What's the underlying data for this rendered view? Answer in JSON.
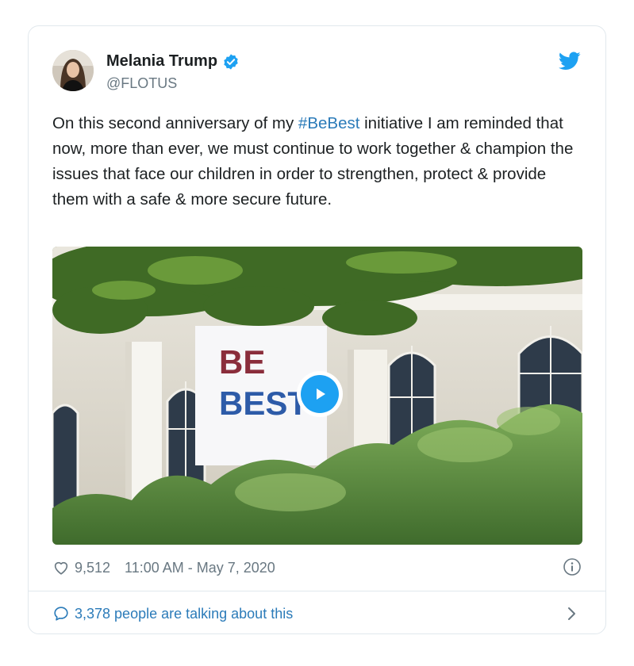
{
  "author": {
    "name": "Melania Trump",
    "handle": "@FLOTUS",
    "verified": true
  },
  "tweet": {
    "text_before": "On this second anniversary of my ",
    "hashtag": "#BeBest",
    "text_after": " initiative I am reminded that now, more than ever, we must continue to work together & champion the issues that face our children in order to strengthen, protect & provide them with a safe & more secure future."
  },
  "media": {
    "type": "video",
    "sign_line1": "BE",
    "sign_line2": "BEST",
    "icon": "play-icon"
  },
  "meta": {
    "likes": "9,512",
    "timestamp": "11:00 AM - May 7, 2020"
  },
  "footer": {
    "talking": "3,378 people are talking about this"
  },
  "colors": {
    "link": "#2b7bb9",
    "twitter_blue": "#1da1f2",
    "muted": "#697882",
    "border": "#e1e8ed"
  },
  "icons": [
    "verified-badge-icon",
    "twitter-bird-icon",
    "heart-icon",
    "info-icon",
    "speech-bubble-icon",
    "chevron-right-icon"
  ]
}
